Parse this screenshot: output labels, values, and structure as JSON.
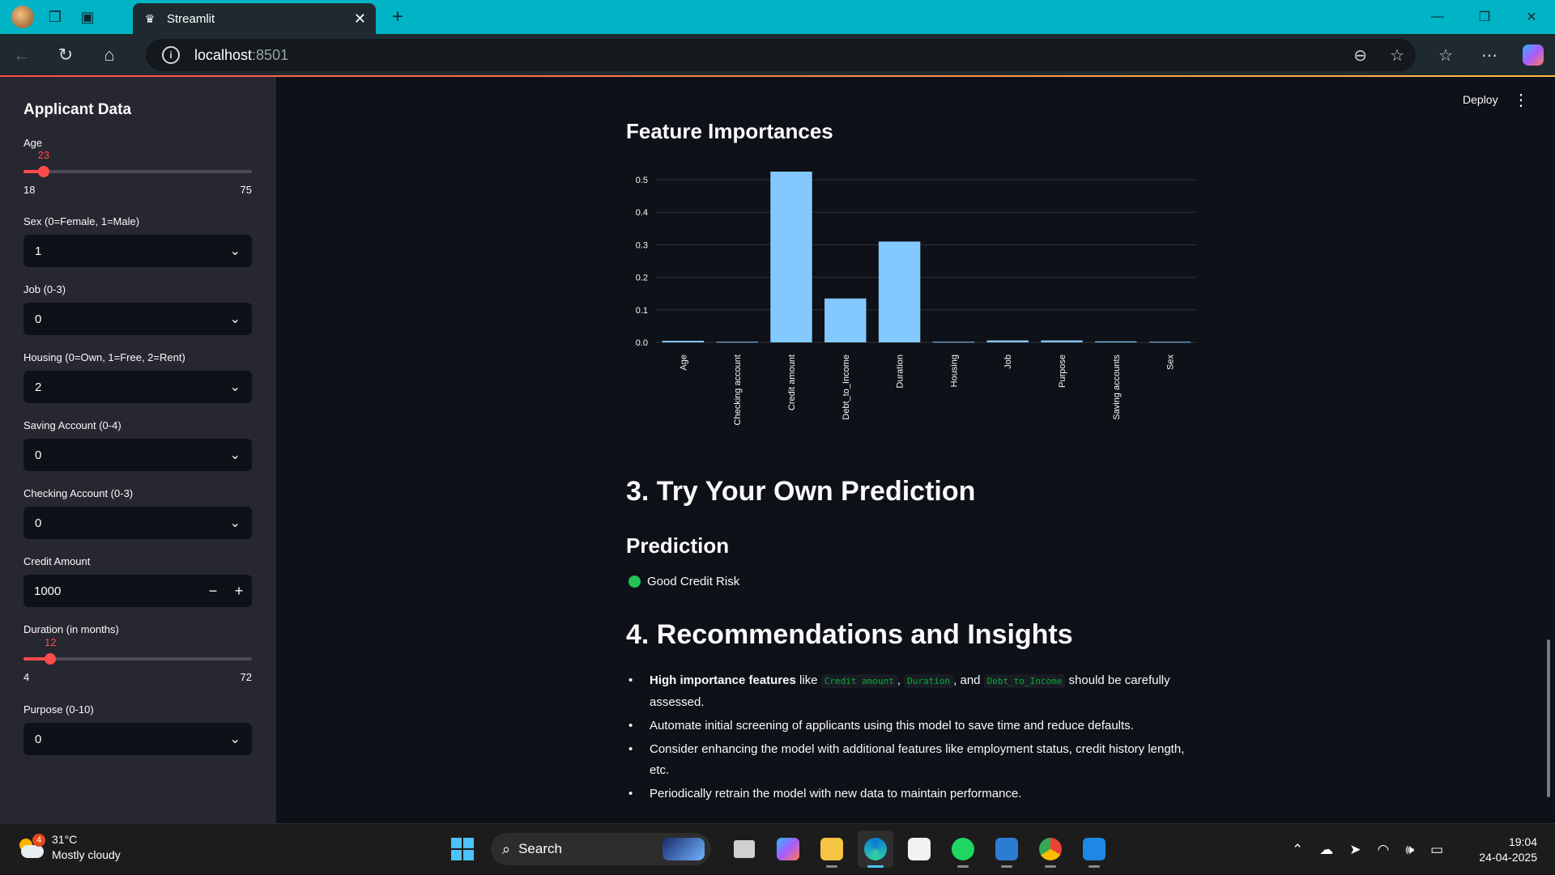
{
  "browser": {
    "tab_title": "Streamlit",
    "url_host": "localhost",
    "url_port": ":8501"
  },
  "sidebar": {
    "title": "Applicant Data",
    "age": {
      "label": "Age",
      "value": "23",
      "min": "18",
      "max": "75",
      "fraction": 0.088
    },
    "sex": {
      "label": "Sex (0=Female, 1=Male)",
      "value": "1"
    },
    "job": {
      "label": "Job (0-3)",
      "value": "0"
    },
    "housing": {
      "label": "Housing (0=Own, 1=Free, 2=Rent)",
      "value": "2"
    },
    "saving": {
      "label": "Saving Account (0-4)",
      "value": "0"
    },
    "checking": {
      "label": "Checking Account (0-3)",
      "value": "0"
    },
    "credit": {
      "label": "Credit Amount",
      "value": "1000",
      "minus": "−",
      "plus": "+"
    },
    "duration": {
      "label": "Duration (in months)",
      "value": "12",
      "min": "4",
      "max": "72",
      "fraction": 0.118
    },
    "purpose": {
      "label": "Purpose (0-10)",
      "value": "0"
    }
  },
  "header": {
    "deploy": "Deploy",
    "menu": "⋮"
  },
  "feature_section": {
    "title": "Feature Importances"
  },
  "chart_data": {
    "type": "bar",
    "categories": [
      "Age",
      "Checking account",
      "Credit amount",
      "Debt_to_Income",
      "Duration",
      "Housing",
      "Job",
      "Purpose",
      "Saving accounts",
      "Sex"
    ],
    "values": [
      0.005,
      0.002,
      0.525,
      0.135,
      0.31,
      0.002,
      0.006,
      0.006,
      0.003,
      0.002
    ],
    "ylim": [
      0,
      0.53
    ],
    "yticks": [
      "0.0",
      "0.1",
      "0.2",
      "0.3",
      "0.4",
      "0.5"
    ],
    "bar_color": "#83c9ff",
    "grid": true
  },
  "section3": {
    "title": "3. Try Your Own Prediction"
  },
  "prediction": {
    "title": "Prediction",
    "result": "Good Credit Risk",
    "status_color": "#21c354"
  },
  "section4": {
    "title": "4. Recommendations and Insights",
    "rec1_bold": "High importance features",
    "rec1_like": " like ",
    "rec1_code1": "Credit amount",
    "rec1_comma": ", ",
    "rec1_code2": "Duration",
    "rec1_and": ", and ",
    "rec1_code3": "Debt_to_Income",
    "rec1_rest": " should be carefully assessed.",
    "rec2": "Automate initial screening of applicants using this model to save time and reduce defaults.",
    "rec3": "Consider enhancing the model with additional features like employment status, credit history length, etc.",
    "rec4": "Periodically retrain the model with new data to maintain performance."
  },
  "taskbar": {
    "weather_badge": "4",
    "temperature": "31°C",
    "condition": "Mostly cloudy",
    "search_label": "Search",
    "time": "19:04",
    "date": "24-04-2025"
  }
}
